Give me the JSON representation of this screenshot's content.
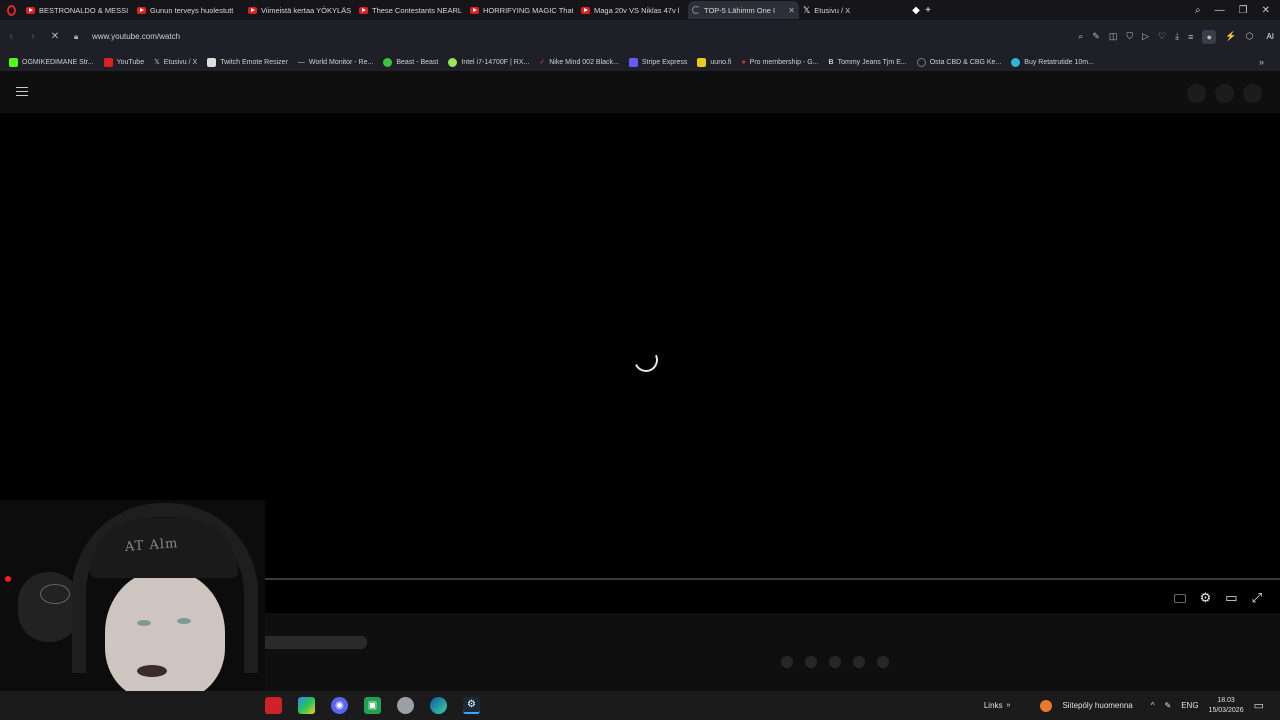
{
  "tabs": [
    {
      "title": "BESTRONALDO & MESSI",
      "active": false
    },
    {
      "title": "Gunun terveys huolestutt",
      "active": false
    },
    {
      "title": "Viimeistä kertaa YÖKYLÄS",
      "active": false
    },
    {
      "title": "These Contestants NEARL",
      "active": false
    },
    {
      "title": "HORRIFYING MAGIC That",
      "active": false
    },
    {
      "title": "Maga 20v VS Niklas 47v l",
      "active": false
    },
    {
      "title": "TOP-5 Lähimm One I",
      "active": true
    },
    {
      "title": "Etusivu / X",
      "active": false
    }
  ],
  "address": {
    "url": "www.youtube.com/watch",
    "ai_label": "AI"
  },
  "bookmarks": [
    "OGMIKEDIMANE Str...",
    "YouTube",
    "Etusivu / X",
    "Twitch Emote Resizer",
    "World Monitor - Re...",
    "Beast - Beast",
    "Intel i7-14700F | RX...",
    "Nike Mind 002 Black...",
    "Stripe Express",
    "uuno.fi",
    "Pro membership - G...",
    "Tommy Jeans Tjm E...",
    "Osta CBD & CBG Ke...",
    "Buy Retatrutide 10m..."
  ],
  "webcam": {
    "cap_text": "AT Alm"
  },
  "taskbar": {
    "links_label": "Links",
    "weather_text": "Siitepöly huomenna",
    "lang": "ENG",
    "time": "18.03",
    "date": "15/03/2026"
  },
  "colors": {
    "accent_red": "#e0262f",
    "youtube_red": "#e02020",
    "page_bg": "#0f0f0f"
  }
}
